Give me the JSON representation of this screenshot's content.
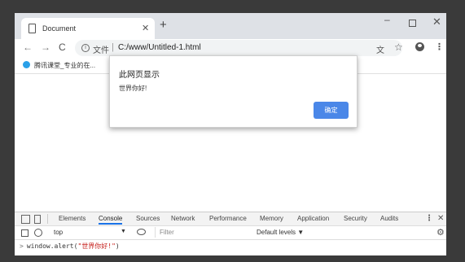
{
  "tab": {
    "title": "Document",
    "close_glyph": "✕",
    "new_tab_glyph": "+"
  },
  "window_controls": {
    "minimize": "–",
    "close": "✕"
  },
  "toolbar": {
    "back": "←",
    "forward": "→",
    "reload": "C",
    "info_glyph": "i",
    "scheme_label": "文件",
    "separator": "|",
    "url": "C:/www/Untitled-1.html",
    "translate_glyph": "文",
    "star_glyph": "☆",
    "menu_glyph": "⋮"
  },
  "bookmarks": [
    {
      "label": "腾讯课堂_专业的在..."
    }
  ],
  "dialog": {
    "title": "此网页显示",
    "message": "世界你好!",
    "ok_label": "确定"
  },
  "devtools": {
    "tabs": [
      "Elements",
      "Console",
      "Sources",
      "Network",
      "Performance",
      "Memory",
      "Application",
      "Security",
      "Audits"
    ],
    "active_tab": "Console",
    "context": "top",
    "context_arrow": "▼",
    "filter_placeholder": "Filter",
    "levels_label": "Default levels ▼",
    "kebab": "⋮",
    "close": "✕",
    "gear": "⚙",
    "console": {
      "prompt": ">",
      "code_prefix": "window.alert(",
      "code_string": "\"世界你好!\"",
      "code_suffix": ")"
    }
  },
  "colors": {
    "accent": "#1a73e8",
    "ok_button": "#4a87e8",
    "string": "#c41a16"
  }
}
